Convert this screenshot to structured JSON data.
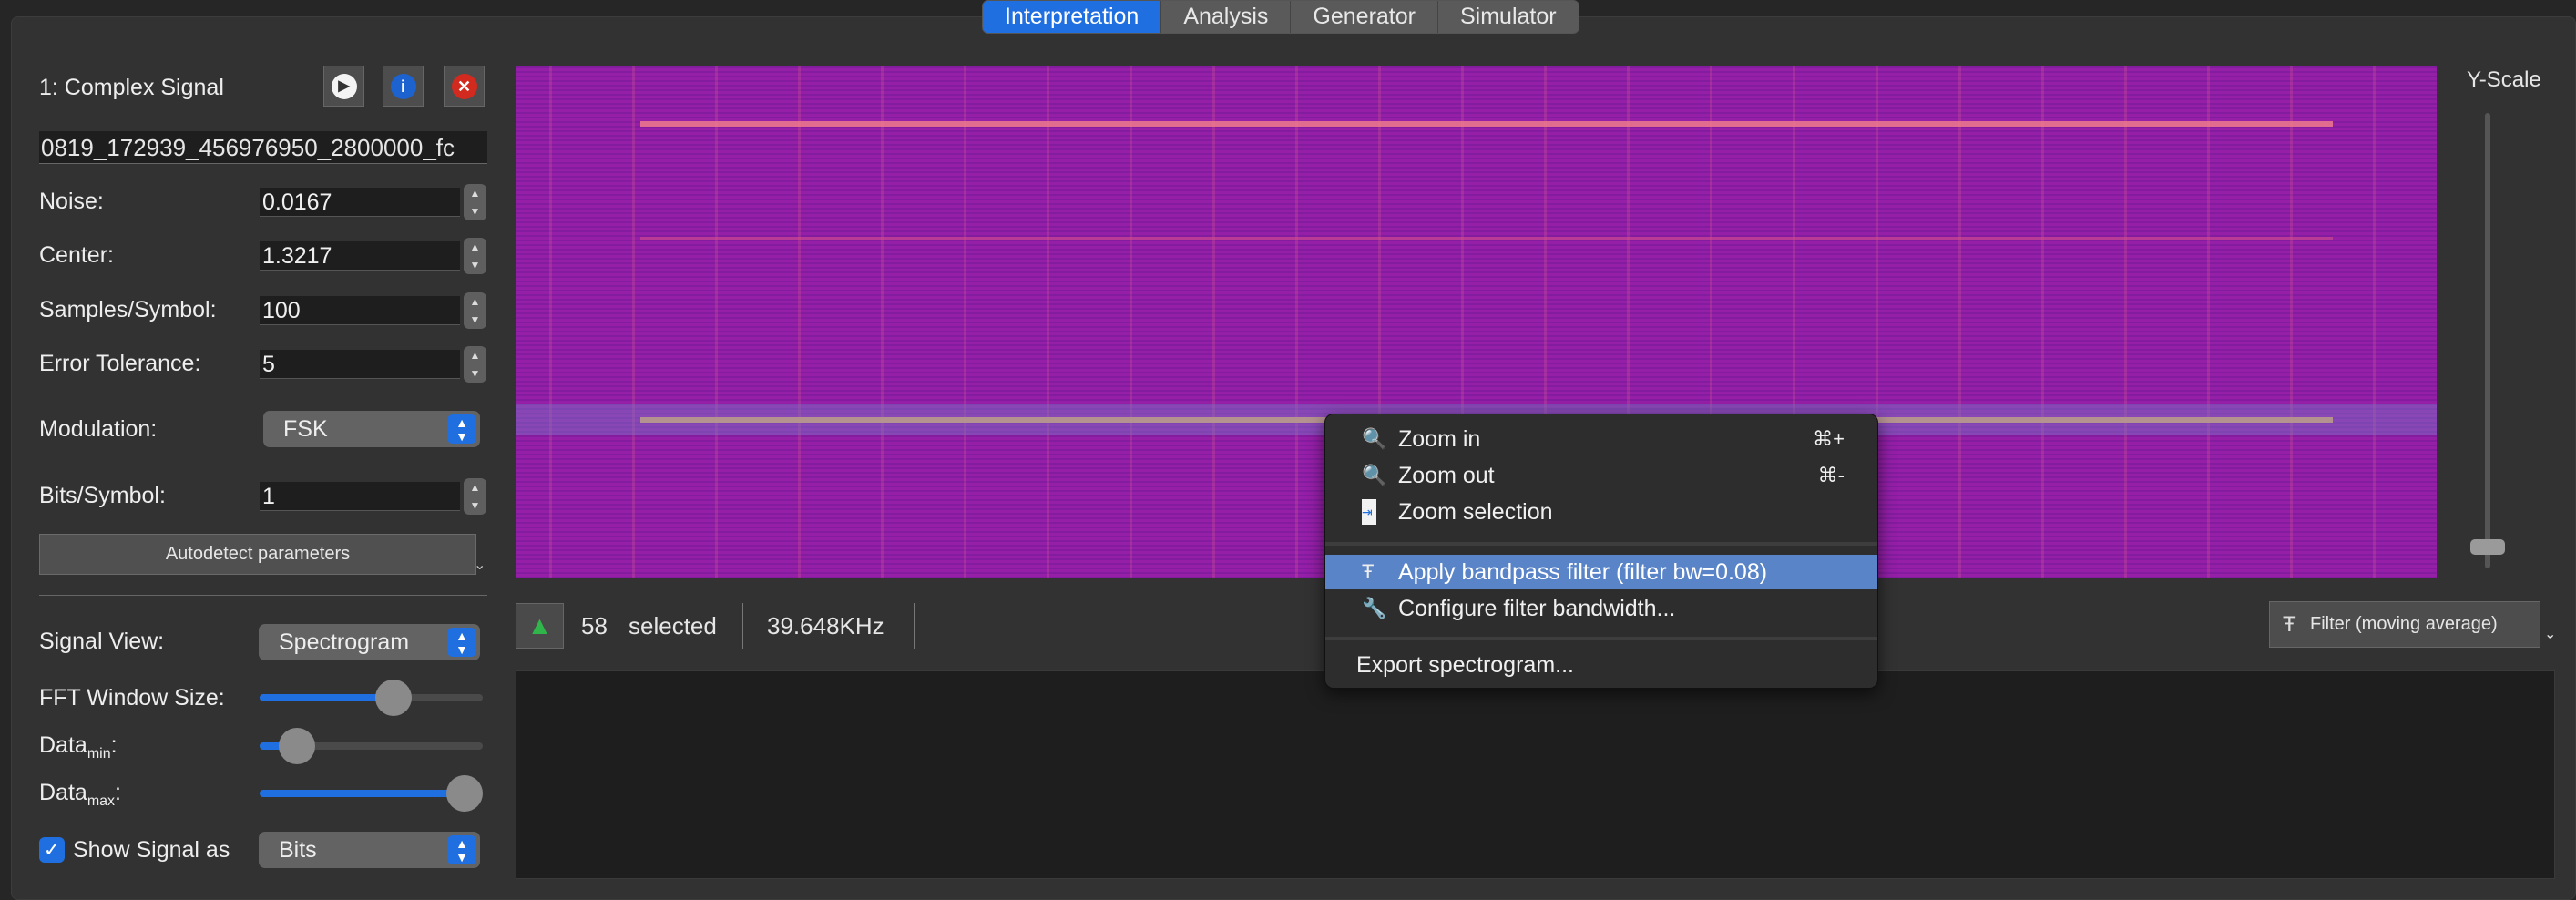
{
  "tabs": [
    "Interpretation",
    "Analysis",
    "Generator",
    "Simulator"
  ],
  "signal": {
    "title": "1:  Complex Signal",
    "filename": "0819_172939_456976950_2800000_fc"
  },
  "params": {
    "noise_label": "Noise:",
    "noise": "0.0167",
    "center_label": "Center:",
    "center": "1.3217",
    "sps_label": "Samples/Symbol:",
    "sps": "100",
    "tol_label": "Error Tolerance:",
    "tol": "5",
    "mod_label": "Modulation:",
    "mod": "FSK",
    "bps_label": "Bits/Symbol:",
    "bps": "1",
    "autodetect": "Autodetect parameters"
  },
  "view": {
    "signal_view_label": "Signal View:",
    "signal_view": "Spectrogram",
    "fft_label": "FFT Window Size:",
    "fft_value": 0.62,
    "datamin_label": "Data",
    "datamin_sub": "min",
    "datamin_value": 0.1,
    "datamax_label": "Data",
    "datamax_sub": "max",
    "datamax_value": 1.0,
    "show_signal_label": "Show Signal as",
    "show_signal_checked": true,
    "show_signal": "Bits"
  },
  "status": {
    "selected_count": "58",
    "selected_label": "selected",
    "frequency": "39.648KHz",
    "filter": "Filter (moving average)"
  },
  "yscale": {
    "label": "Y-Scale",
    "value": 0.08
  },
  "menu": {
    "zoom_in": "Zoom in",
    "zoom_in_sc": "⌘+",
    "zoom_out": "Zoom out",
    "zoom_out_sc": "⌘-",
    "zoom_sel": "Zoom selection",
    "bandpass": "Apply bandpass filter (filter bw=0.08)",
    "configure": "Configure filter bandwidth...",
    "export": "Export spectrogram..."
  },
  "colors": {
    "accent": "#1f6fe0",
    "highlight": "#5a84c8",
    "spectrogram": "#951fa6"
  }
}
